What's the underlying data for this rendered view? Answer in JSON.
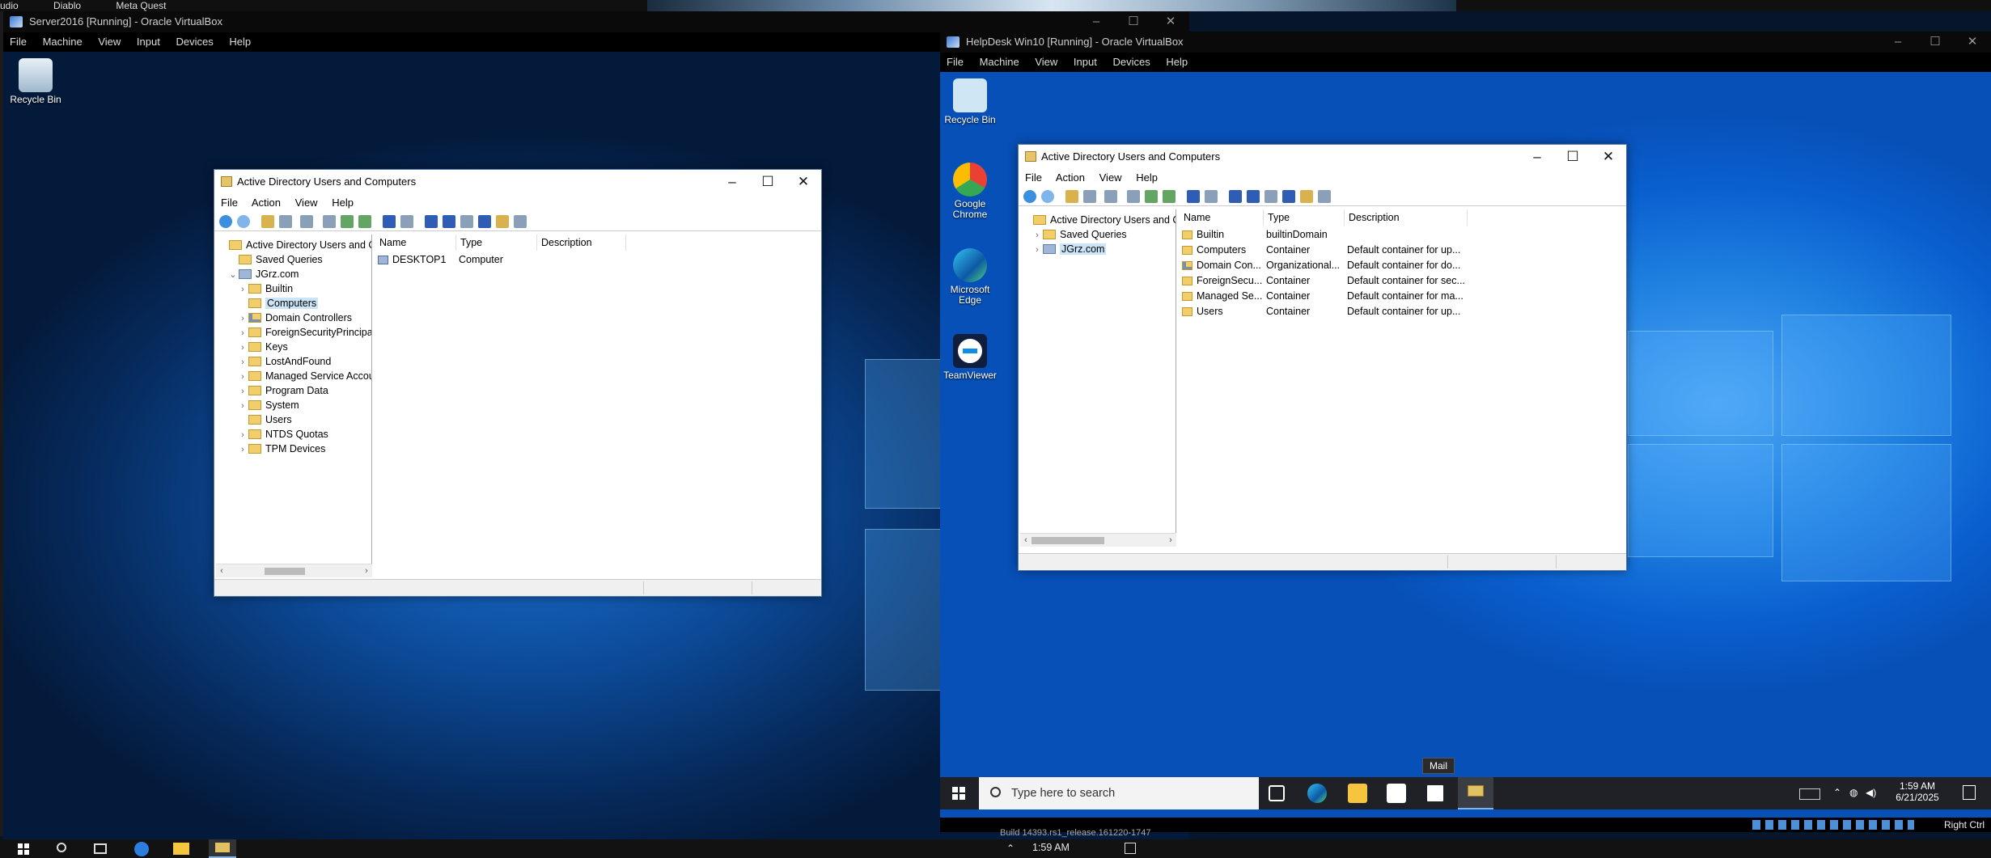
{
  "host": {
    "top_items": [
      "udio",
      "Diablo",
      "Meta Quest"
    ],
    "taskbar_time": "1:59 AM",
    "taskbar_build": "Build 14393.rs1_release.161220-1747"
  },
  "vm_left": {
    "title": "Server2016 [Running] - Oracle VirtualBox",
    "menu": [
      "File",
      "Machine",
      "View",
      "Input",
      "Devices",
      "Help"
    ],
    "recycle_bin": "Recycle Bin",
    "mmc": {
      "title": "Active Directory Users and Computers",
      "menu": [
        "File",
        "Action",
        "View",
        "Help"
      ],
      "tree": [
        {
          "label": "Active Directory Users and Com",
          "level": 0,
          "chev": "",
          "icon": "root"
        },
        {
          "label": "Saved Queries",
          "level": 1,
          "chev": "",
          "icon": "folder"
        },
        {
          "label": "JGrz.com",
          "level": 1,
          "chev": "⌄",
          "icon": "domain"
        },
        {
          "label": "Builtin",
          "level": 2,
          "chev": "›",
          "icon": "folder"
        },
        {
          "label": "Computers",
          "level": 2,
          "chev": "",
          "icon": "folder",
          "selected": true
        },
        {
          "label": "Domain Controllers",
          "level": 2,
          "chev": "›",
          "icon": "ou"
        },
        {
          "label": "ForeignSecurityPrincipals",
          "level": 2,
          "chev": "›",
          "icon": "folder"
        },
        {
          "label": "Keys",
          "level": 2,
          "chev": "›",
          "icon": "folder"
        },
        {
          "label": "LostAndFound",
          "level": 2,
          "chev": "›",
          "icon": "folder"
        },
        {
          "label": "Managed Service Accour",
          "level": 2,
          "chev": "›",
          "icon": "folder"
        },
        {
          "label": "Program Data",
          "level": 2,
          "chev": "›",
          "icon": "folder"
        },
        {
          "label": "System",
          "level": 2,
          "chev": "›",
          "icon": "folder"
        },
        {
          "label": "Users",
          "level": 2,
          "chev": "",
          "icon": "folder"
        },
        {
          "label": "NTDS Quotas",
          "level": 2,
          "chev": "›",
          "icon": "folder"
        },
        {
          "label": "TPM Devices",
          "level": 2,
          "chev": "›",
          "icon": "folder"
        }
      ],
      "columns": [
        "Name",
        "Type",
        "Description"
      ],
      "rows": [
        {
          "name": "DESKTOP1",
          "type": "Computer",
          "description": ""
        }
      ]
    }
  },
  "vm_right": {
    "title": "HelpDesk Win10 [Running] - Oracle VirtualBox",
    "menu": [
      "File",
      "Machine",
      "View",
      "Input",
      "Devices",
      "Help"
    ],
    "desktop_icons": [
      {
        "label": "Recycle Bin",
        "icon": "recycle-bin-icon",
        "color": "#cfe6f5"
      },
      {
        "label": "Google Chrome",
        "icon": "chrome-icon",
        "color": "#e94235"
      },
      {
        "label": "Microsoft Edge",
        "icon": "edge-icon",
        "color": "#1fa5d8"
      },
      {
        "label": "TeamViewer",
        "icon": "teamviewer-icon",
        "color": "#0e8ee9"
      }
    ],
    "mmc": {
      "title": "Active Directory Users and Computers",
      "menu": [
        "File",
        "Action",
        "View",
        "Help"
      ],
      "tree": [
        {
          "label": "Active Directory Users and Com",
          "level": 0,
          "chev": "",
          "icon": "root"
        },
        {
          "label": "Saved Queries",
          "level": 1,
          "chev": "›",
          "icon": "folder"
        },
        {
          "label": "JGrz.com",
          "level": 1,
          "chev": "›",
          "icon": "domain",
          "selected": true
        }
      ],
      "columns": [
        "Name",
        "Type",
        "Description"
      ],
      "rows": [
        {
          "name": "Builtin",
          "type": "builtinDomain",
          "description": ""
        },
        {
          "name": "Computers",
          "type": "Container",
          "description": "Default container for up..."
        },
        {
          "name": "Domain Con...",
          "type": "Organizational...",
          "description": "Default container for do..."
        },
        {
          "name": "ForeignSecu...",
          "type": "Container",
          "description": "Default container for sec..."
        },
        {
          "name": "Managed Se...",
          "type": "Container",
          "description": "Default container for ma..."
        },
        {
          "name": "Users",
          "type": "Container",
          "description": "Default container for up..."
        }
      ]
    },
    "taskbar": {
      "search_placeholder": "Type here to search",
      "tooltip": "Mail",
      "time": "1:59 AM",
      "date": "6/21/2025"
    },
    "status_key": "Right Ctrl"
  }
}
